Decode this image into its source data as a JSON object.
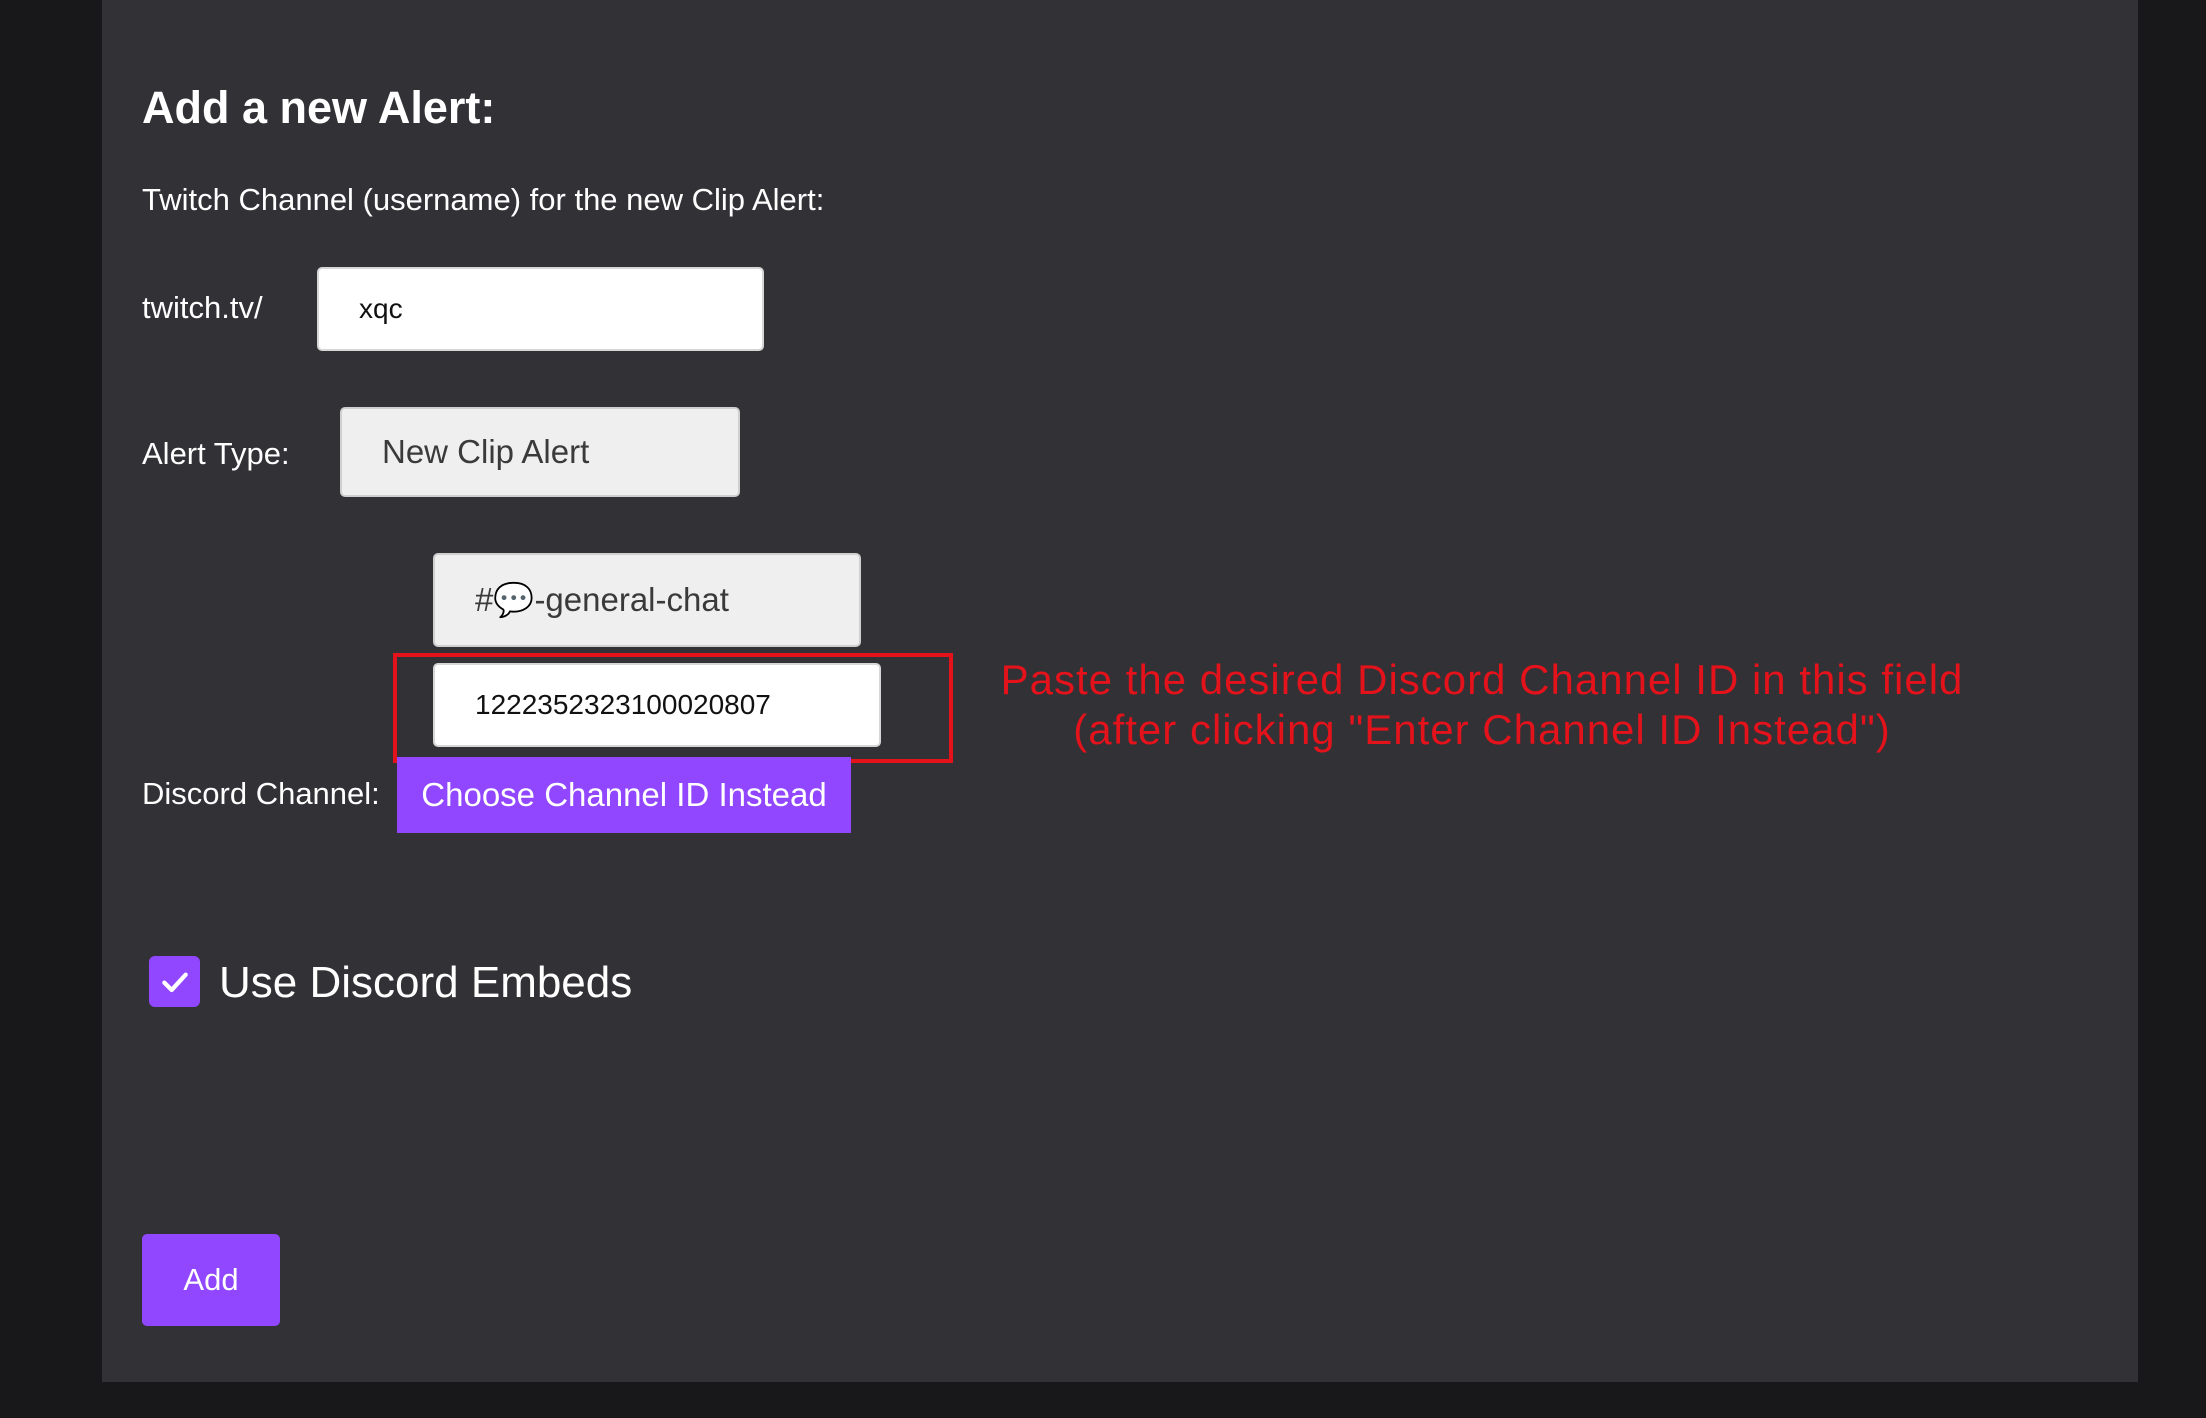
{
  "form": {
    "title": "Add a new Alert:",
    "subtitle": "Twitch Channel (username) for the new Clip Alert:",
    "twitch_prefix": "twitch.tv/",
    "twitch_username_value": "xqc",
    "alert_type_label": "Alert Type:",
    "alert_type_value": "New Clip Alert",
    "discord_channel_label": "Discord Channel:",
    "discord_channel_select_value": "#💬-general-chat",
    "discord_channel_id_value": "1222352323100020807",
    "choose_channel_button": "Choose Channel ID Instead",
    "use_embeds_label": "Use Discord Embeds",
    "use_embeds_checked": true,
    "add_button": "Add"
  },
  "annotation": {
    "line1": "Paste the desired Discord Channel ID in this field",
    "line2": "(after clicking \"Enter Channel ID Instead\")"
  },
  "colors": {
    "page_background": "#18181b",
    "panel_background": "#313136",
    "accent_purple": "#9146ff",
    "annotation_red": "#e3121b"
  },
  "icons": {
    "checkbox": "checkmark-icon"
  }
}
